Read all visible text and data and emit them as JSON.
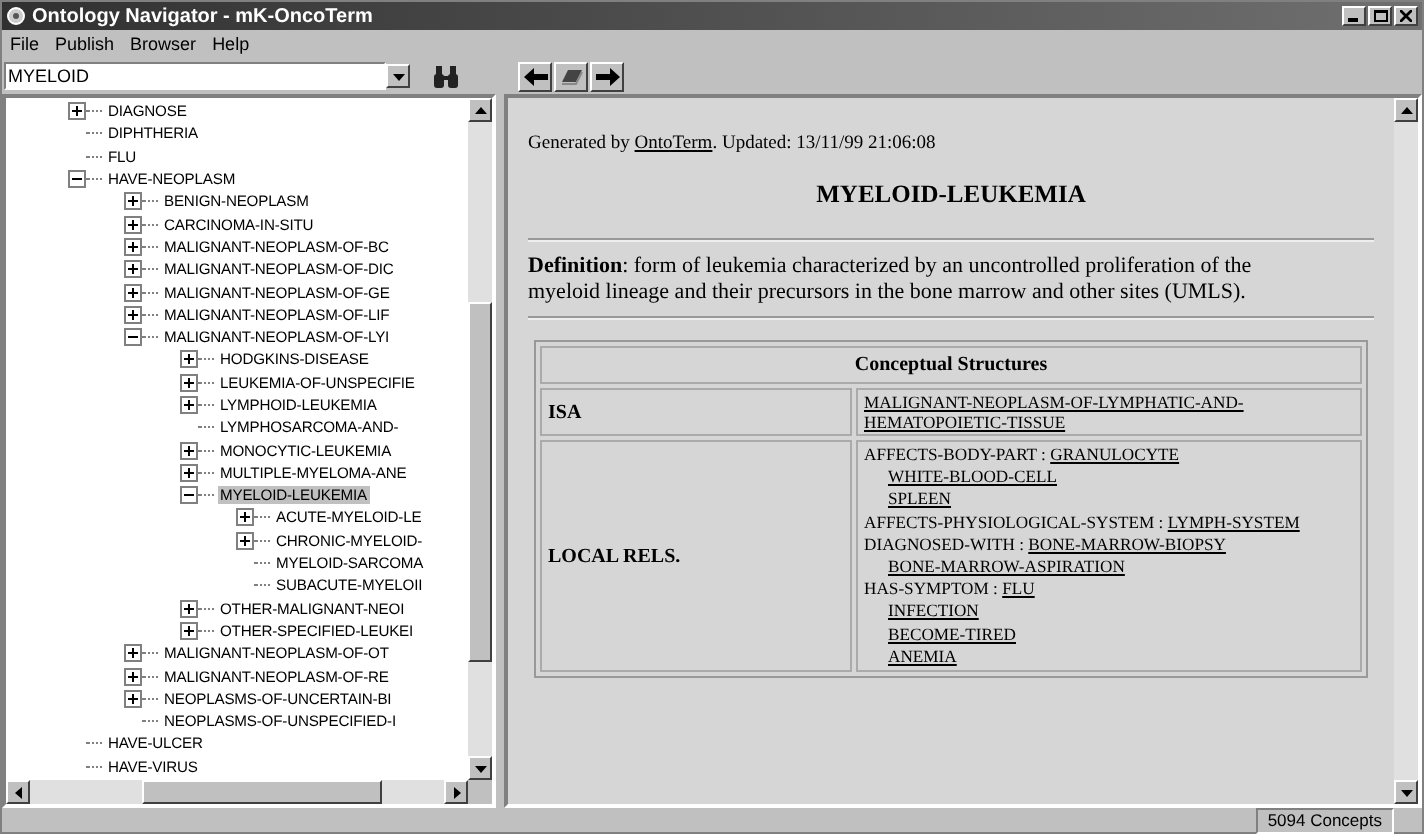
{
  "window": {
    "title": "Ontology Navigator - mK-OncoTerm"
  },
  "menu": [
    "File",
    "Publish",
    "Browser",
    "Help"
  ],
  "search": {
    "value": "MYELOID"
  },
  "tree": [
    {
      "label": "DIAGNOSE",
      "kind": "folder",
      "expanded": false,
      "selected": false
    },
    {
      "label": "DIPHTHERIA",
      "kind": "leaf",
      "selected": false
    },
    {
      "label": "FLU",
      "kind": "leaf",
      "selected": false
    },
    {
      "label": "HAVE-NEOPLASM",
      "kind": "folder",
      "expanded": true,
      "selected": false,
      "children": [
        {
          "label": "BENIGN-NEOPLASM",
          "kind": "folder",
          "expanded": false,
          "selected": false
        },
        {
          "label": "CARCINOMA-IN-SITU",
          "kind": "folder",
          "expanded": false,
          "selected": false
        },
        {
          "label": "MALIGNANT-NEOPLASM-OF-BC",
          "kind": "folder",
          "expanded": false,
          "selected": false
        },
        {
          "label": "MALIGNANT-NEOPLASM-OF-DIC",
          "kind": "folder",
          "expanded": false,
          "selected": false
        },
        {
          "label": "MALIGNANT-NEOPLASM-OF-GE",
          "kind": "folder",
          "expanded": false,
          "selected": false
        },
        {
          "label": "MALIGNANT-NEOPLASM-OF-LIF",
          "kind": "folder",
          "expanded": false,
          "selected": false
        },
        {
          "label": "MALIGNANT-NEOPLASM-OF-LYI",
          "kind": "folder",
          "expanded": true,
          "selected": false,
          "children": [
            {
              "label": "HODGKINS-DISEASE",
              "kind": "folder",
              "expanded": false,
              "selected": false
            },
            {
              "label": "LEUKEMIA-OF-UNSPECIFIE",
              "kind": "folder",
              "expanded": false,
              "selected": false
            },
            {
              "label": "LYMPHOID-LEUKEMIA",
              "kind": "folder",
              "expanded": false,
              "selected": false
            },
            {
              "label": "LYMPHOSARCOMA-AND-",
              "kind": "leaf",
              "selected": false
            },
            {
              "label": "MONOCYTIC-LEUKEMIA",
              "kind": "folder",
              "expanded": false,
              "selected": false
            },
            {
              "label": "MULTIPLE-MYELOMA-ANE",
              "kind": "folder",
              "expanded": false,
              "selected": false
            },
            {
              "label": "MYELOID-LEUKEMIA",
              "kind": "folder",
              "expanded": true,
              "selected": true,
              "children": [
                {
                  "label": "ACUTE-MYELOID-LE",
                  "kind": "folder",
                  "expanded": false,
                  "selected": false
                },
                {
                  "label": "CHRONIC-MYELOID-",
                  "kind": "folder",
                  "expanded": false,
                  "selected": false
                },
                {
                  "label": "MYELOID-SARCOMA",
                  "kind": "leaf",
                  "selected": false
                },
                {
                  "label": "SUBACUTE-MYELOII",
                  "kind": "leaf",
                  "selected": false
                }
              ]
            },
            {
              "label": "OTHER-MALIGNANT-NEOI",
              "kind": "folder",
              "expanded": false,
              "selected": false
            },
            {
              "label": "OTHER-SPECIFIED-LEUKEI",
              "kind": "folder",
              "expanded": false,
              "selected": false
            }
          ]
        },
        {
          "label": "MALIGNANT-NEOPLASM-OF-OT",
          "kind": "folder",
          "expanded": false,
          "selected": false
        },
        {
          "label": "MALIGNANT-NEOPLASM-OF-RE",
          "kind": "folder",
          "expanded": false,
          "selected": false
        },
        {
          "label": "NEOPLASMS-OF-UNCERTAIN-BI",
          "kind": "folder",
          "expanded": false,
          "selected": false
        },
        {
          "label": "NEOPLASMS-OF-UNSPECIFIED-I",
          "kind": "leaf",
          "selected": false
        }
      ]
    },
    {
      "label": "HAVE-ULCER",
      "kind": "leaf",
      "selected": false
    },
    {
      "label": "HAVE-VIRUS",
      "kind": "leaf",
      "selected": false
    }
  ],
  "page": {
    "generated_prefix": "Generated by",
    "generated_link": "OntoTerm",
    "generated_suffix": ". Updated: 13/11/99 21:06:08",
    "title": "MYELOID-LEUKEMIA",
    "definition": "**Definition**: form of leukemia characterized by an uncontrolled proliferation of the myeloid lineage and their precursors in the bone marrow and other sites (UMLS).",
    "table": {
      "heading": "Conceptual Structures",
      "isa_label": "ISA",
      "isa_value": "MALIGNANT-NEOPLASM-OF-LYMPHATIC-AND-HEMATOPOIETIC-TISSUE",
      "local_label": "LOCAL RELS.",
      "relations": [
        {
          "name": "AFFECTS-BODY-PART :",
          "values": [
            "GRANULOCYTE",
            "WHITE-BLOOD-CELL",
            "SPLEEN"
          ]
        },
        {
          "name": "AFFECTS-PHYSIOLOGICAL-SYSTEM :",
          "values": [
            "LYMPH-SYSTEM"
          ]
        },
        {
          "name": "DIAGNOSED-WITH :",
          "values": [
            "BONE-MARROW-BIOPSY",
            "BONE-MARROW-ASPIRATION"
          ]
        },
        {
          "name": "HAS-SYMPTOM :",
          "values": [
            "FLU",
            "INFECTION",
            "BECOME-TIRED",
            "ANEMIA"
          ]
        }
      ]
    }
  },
  "status_bar": {
    "count": "5094 Concepts"
  }
}
